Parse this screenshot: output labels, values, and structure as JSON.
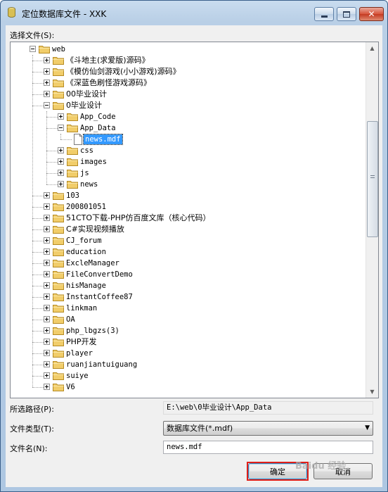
{
  "window": {
    "title": "定位数据库文件 - XXK",
    "minimize": "minimize",
    "maximize": "maximize",
    "close": "close"
  },
  "select_file_label": "选择文件(S):",
  "tree": [
    {
      "text": "web",
      "level": 0,
      "type": "folder",
      "exp": "minus"
    },
    {
      "text": "《斗地主(求爱版)源码》",
      "level": 1,
      "type": "folder",
      "exp": "plus"
    },
    {
      "text": "《模仿仙剑游戏(小小游戏)源码》",
      "level": 1,
      "type": "folder",
      "exp": "plus"
    },
    {
      "text": "《深蓝色刷怪游戏源码》",
      "level": 1,
      "type": "folder",
      "exp": "plus"
    },
    {
      "text": "00毕业设计",
      "level": 1,
      "type": "folder",
      "exp": "plus"
    },
    {
      "text": "0毕业设计",
      "level": 1,
      "type": "folder",
      "exp": "minus"
    },
    {
      "text": "App_Code",
      "level": 2,
      "type": "folder",
      "exp": "plus"
    },
    {
      "text": "App_Data",
      "level": 2,
      "type": "folder",
      "exp": "minus"
    },
    {
      "text": "news.mdf",
      "level": 3,
      "type": "file",
      "selected": true
    },
    {
      "text": "css",
      "level": 2,
      "type": "folder",
      "exp": "plus"
    },
    {
      "text": "images",
      "level": 2,
      "type": "folder",
      "exp": "plus"
    },
    {
      "text": "js",
      "level": 2,
      "type": "folder",
      "exp": "plus"
    },
    {
      "text": "news",
      "level": 2,
      "type": "folder",
      "exp": "plus"
    },
    {
      "text": "103",
      "level": 1,
      "type": "folder",
      "exp": "plus"
    },
    {
      "text": "200801051",
      "level": 1,
      "type": "folder",
      "exp": "plus"
    },
    {
      "text": "51CTO下载-PHP仿百度文库（核心代码）",
      "level": 1,
      "type": "folder",
      "exp": "plus"
    },
    {
      "text": "C#实现视频播放",
      "level": 1,
      "type": "folder",
      "exp": "plus"
    },
    {
      "text": "CJ_forum",
      "level": 1,
      "type": "folder",
      "exp": "plus"
    },
    {
      "text": "education",
      "level": 1,
      "type": "folder",
      "exp": "plus"
    },
    {
      "text": "ExcleManager",
      "level": 1,
      "type": "folder",
      "exp": "plus"
    },
    {
      "text": "FileConvertDemo",
      "level": 1,
      "type": "folder",
      "exp": "plus"
    },
    {
      "text": "hisManage",
      "level": 1,
      "type": "folder",
      "exp": "plus"
    },
    {
      "text": "InstantCoffee87",
      "level": 1,
      "type": "folder",
      "exp": "plus"
    },
    {
      "text": "linkman",
      "level": 1,
      "type": "folder",
      "exp": "plus"
    },
    {
      "text": "OA",
      "level": 1,
      "type": "folder",
      "exp": "plus"
    },
    {
      "text": "php_lbgzs(3)",
      "level": 1,
      "type": "folder",
      "exp": "plus"
    },
    {
      "text": "PHP开发",
      "level": 1,
      "type": "folder",
      "exp": "plus"
    },
    {
      "text": "player",
      "level": 1,
      "type": "folder",
      "exp": "plus"
    },
    {
      "text": "ruanjiantuiguang",
      "level": 1,
      "type": "folder",
      "exp": "plus"
    },
    {
      "text": "suiye",
      "level": 1,
      "type": "folder",
      "exp": "plus"
    },
    {
      "text": "V6",
      "level": 1,
      "type": "folder",
      "exp": "plus"
    }
  ],
  "path_label": "所选路径(P):",
  "path_value": "E:\\web\\0毕业设计\\App_Data",
  "type_label": "文件类型(T):",
  "type_value": "数据库文件(*.mdf)",
  "name_label": "文件名(N):",
  "name_value": "news.mdf",
  "ok_label": "确定",
  "cancel_label": "取消",
  "watermark": "Baidu 经验",
  "colors": {
    "selection": "#3399ff",
    "highlight_box": "#e0201a",
    "folder": "#f1cd6a"
  }
}
